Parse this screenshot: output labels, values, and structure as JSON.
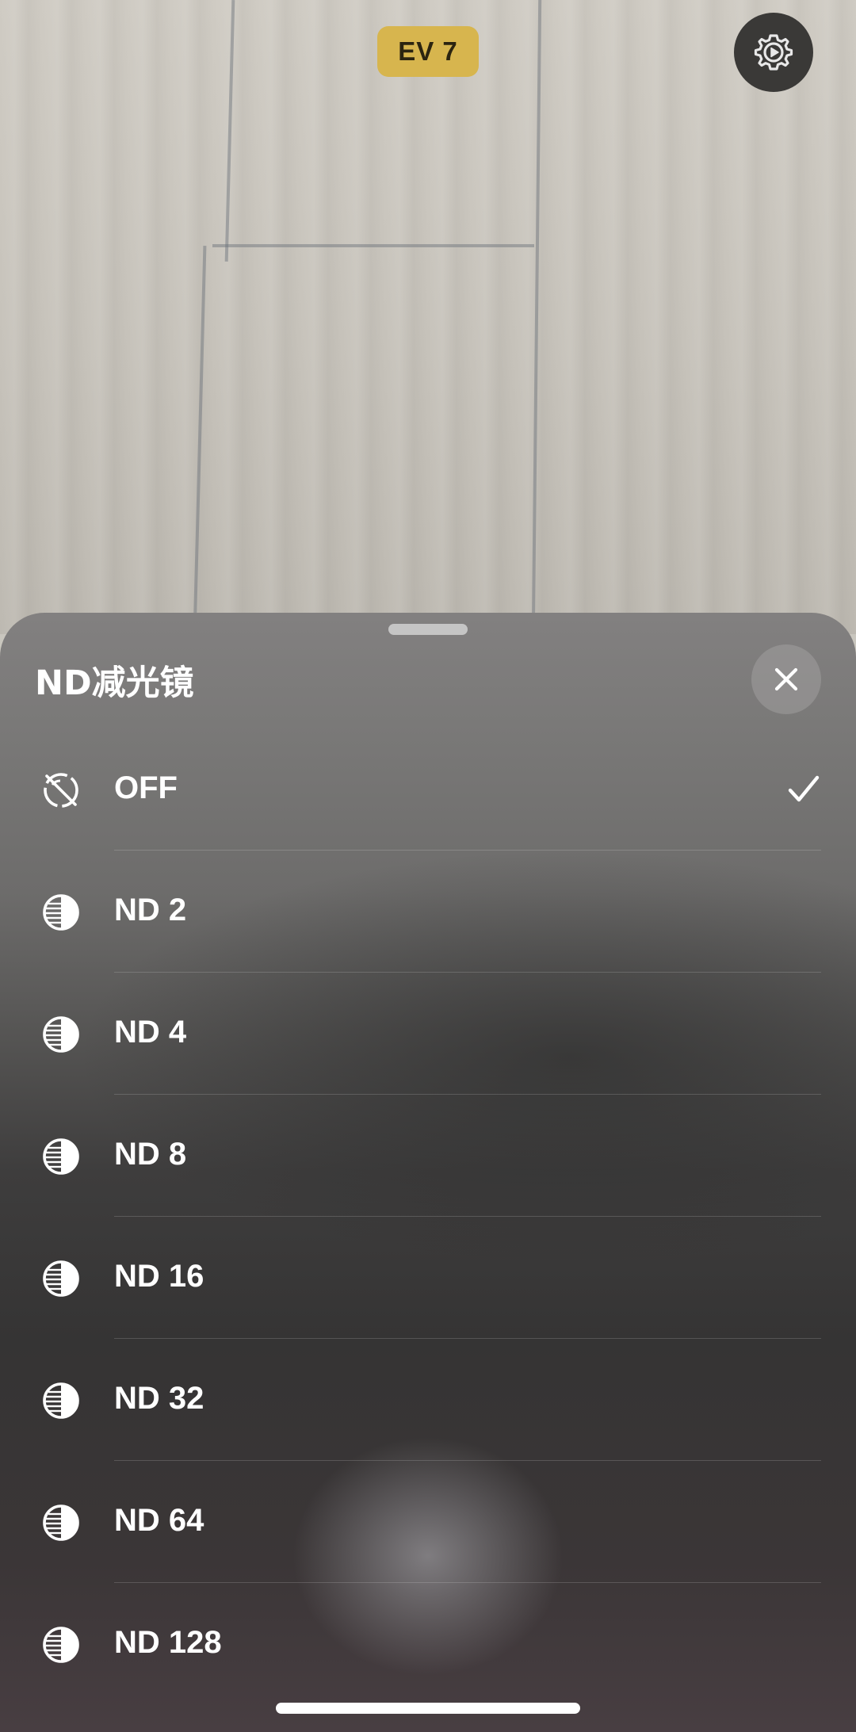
{
  "viewfinder": {
    "ev_label": "EV 7",
    "settings_icon": "gear-play-icon"
  },
  "sheet": {
    "title": "ND减光镜",
    "close_icon": "close-icon",
    "selected_icon": "checkmark-icon",
    "options": [
      {
        "label": "OFF",
        "icon": "nd-off-icon",
        "selected": true
      },
      {
        "label": "ND 2",
        "icon": "nd-filter-icon",
        "selected": false
      },
      {
        "label": "ND 4",
        "icon": "nd-filter-icon",
        "selected": false
      },
      {
        "label": "ND 8",
        "icon": "nd-filter-icon",
        "selected": false
      },
      {
        "label": "ND 16",
        "icon": "nd-filter-icon",
        "selected": false
      },
      {
        "label": "ND 32",
        "icon": "nd-filter-icon",
        "selected": false
      },
      {
        "label": "ND 64",
        "icon": "nd-filter-icon",
        "selected": false
      },
      {
        "label": "ND 128",
        "icon": "nd-filter-icon",
        "selected": false
      }
    ]
  },
  "colors": {
    "ev_badge": "#d7b54e",
    "text": "#ffffff"
  }
}
